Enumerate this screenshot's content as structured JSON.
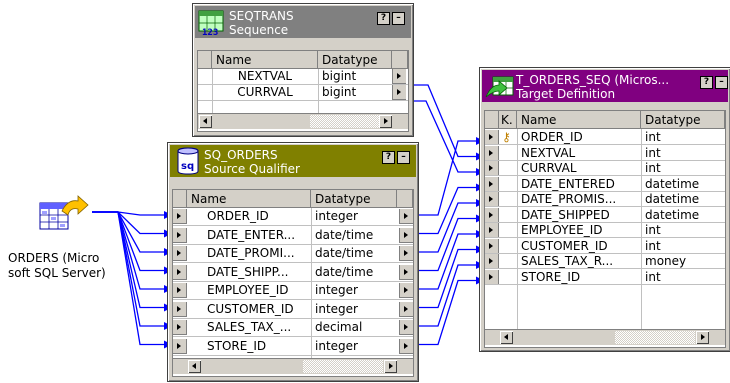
{
  "source": {
    "label_line1": "ORDERS (Micro",
    "label_line2": "soft SQL Server)"
  },
  "seqtrans": {
    "title": "SEQTRANS",
    "subtitle": "Sequence",
    "title_color": "#808080",
    "col_name": "Name",
    "col_datatype": "Datatype",
    "rows": [
      {
        "name": "NEXTVAL",
        "type": "bigint"
      },
      {
        "name": "CURRVAL",
        "type": "bigint"
      }
    ]
  },
  "sq_orders": {
    "title": "SQ_ORDERS",
    "subtitle": "Source Qualifier",
    "title_color": "#808000",
    "col_name": "Name",
    "col_datatype": "Datatype",
    "rows": [
      {
        "name": "ORDER_ID",
        "type": "integer"
      },
      {
        "name": "DATE_ENTER...",
        "type": "date/time"
      },
      {
        "name": "DATE_PROMI...",
        "type": "date/time"
      },
      {
        "name": "DATE_SHIPP...",
        "type": "date/time"
      },
      {
        "name": "EMPLOYEE_ID",
        "type": "integer"
      },
      {
        "name": "CUSTOMER_ID",
        "type": "integer"
      },
      {
        "name": "SALES_TAX_...",
        "type": "decimal"
      },
      {
        "name": "STORE_ID",
        "type": "integer"
      }
    ]
  },
  "target": {
    "title": "T_ORDERS_SEQ (Micros...",
    "subtitle": "Target Definition",
    "title_color": "#800080",
    "col_key": "K.",
    "col_name": "Name",
    "col_datatype": "Datatype",
    "rows": [
      {
        "name": "ORDER_ID",
        "type": "int",
        "key": true
      },
      {
        "name": "NEXTVAL",
        "type": "int"
      },
      {
        "name": "CURRVAL",
        "type": "int"
      },
      {
        "name": "DATE_ENTERED",
        "type": "datetime"
      },
      {
        "name": "DATE_PROMIS...",
        "type": "datetime"
      },
      {
        "name": "DATE_SHIPPED",
        "type": "datetime"
      },
      {
        "name": "EMPLOYEE_ID",
        "type": "int"
      },
      {
        "name": "CUSTOMER_ID",
        "type": "int"
      },
      {
        "name": "SALES_TAX_R...",
        "type": "money"
      },
      {
        "name": "STORE_ID",
        "type": "int"
      }
    ]
  },
  "buttons": {
    "help": "?",
    "minimize": "–"
  },
  "link_color": "#0000ff"
}
